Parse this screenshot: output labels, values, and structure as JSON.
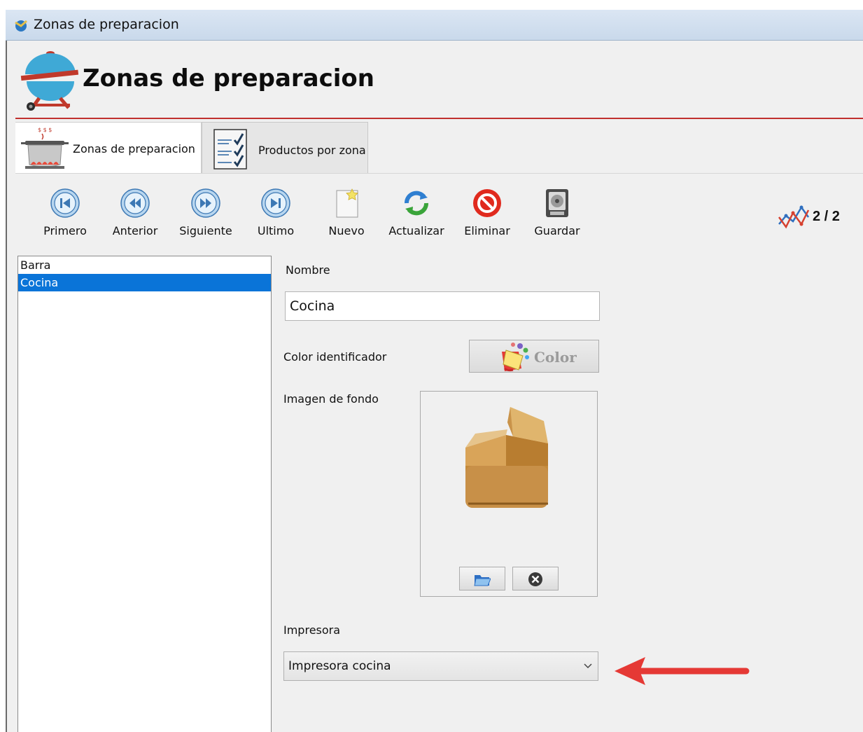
{
  "window": {
    "title": "Zonas de preparacion"
  },
  "header": {
    "title": "Zonas de preparacion",
    "icon": "barbecue-grill-icon"
  },
  "tabs": [
    {
      "label": "Zonas de preparacion",
      "icon": "cooking-pot-icon",
      "active": true
    },
    {
      "label": "Productos por zona",
      "icon": "checklist-icon",
      "active": false
    }
  ],
  "toolbar": {
    "buttons": [
      {
        "label": "Primero",
        "icon": "first-record-icon"
      },
      {
        "label": "Anterior",
        "icon": "previous-record-icon"
      },
      {
        "label": "Siguiente",
        "icon": "next-record-icon"
      },
      {
        "label": "Ultimo",
        "icon": "last-record-icon"
      },
      {
        "label": "Nuevo",
        "icon": "new-document-icon"
      },
      {
        "label": "Actualizar",
        "icon": "refresh-icon"
      },
      {
        "label": "Eliminar",
        "icon": "delete-icon"
      },
      {
        "label": "Guardar",
        "icon": "save-disk-icon"
      }
    ],
    "record_count": "2 / 2"
  },
  "list": {
    "items": [
      "Barra",
      "Cocina"
    ],
    "selected": "Cocina"
  },
  "form": {
    "nombre_label": "Nombre",
    "nombre_value": "Cocina",
    "color_label": "Color identificador",
    "color_button": "Color",
    "imagen_label": "Imagen de fondo",
    "impresora_label": "Impresora",
    "impresora_value": "Impresora cocina"
  },
  "colors": {
    "selection": "#0a74d8",
    "header_rule": "#c0302e",
    "arrow": "#e53935"
  }
}
